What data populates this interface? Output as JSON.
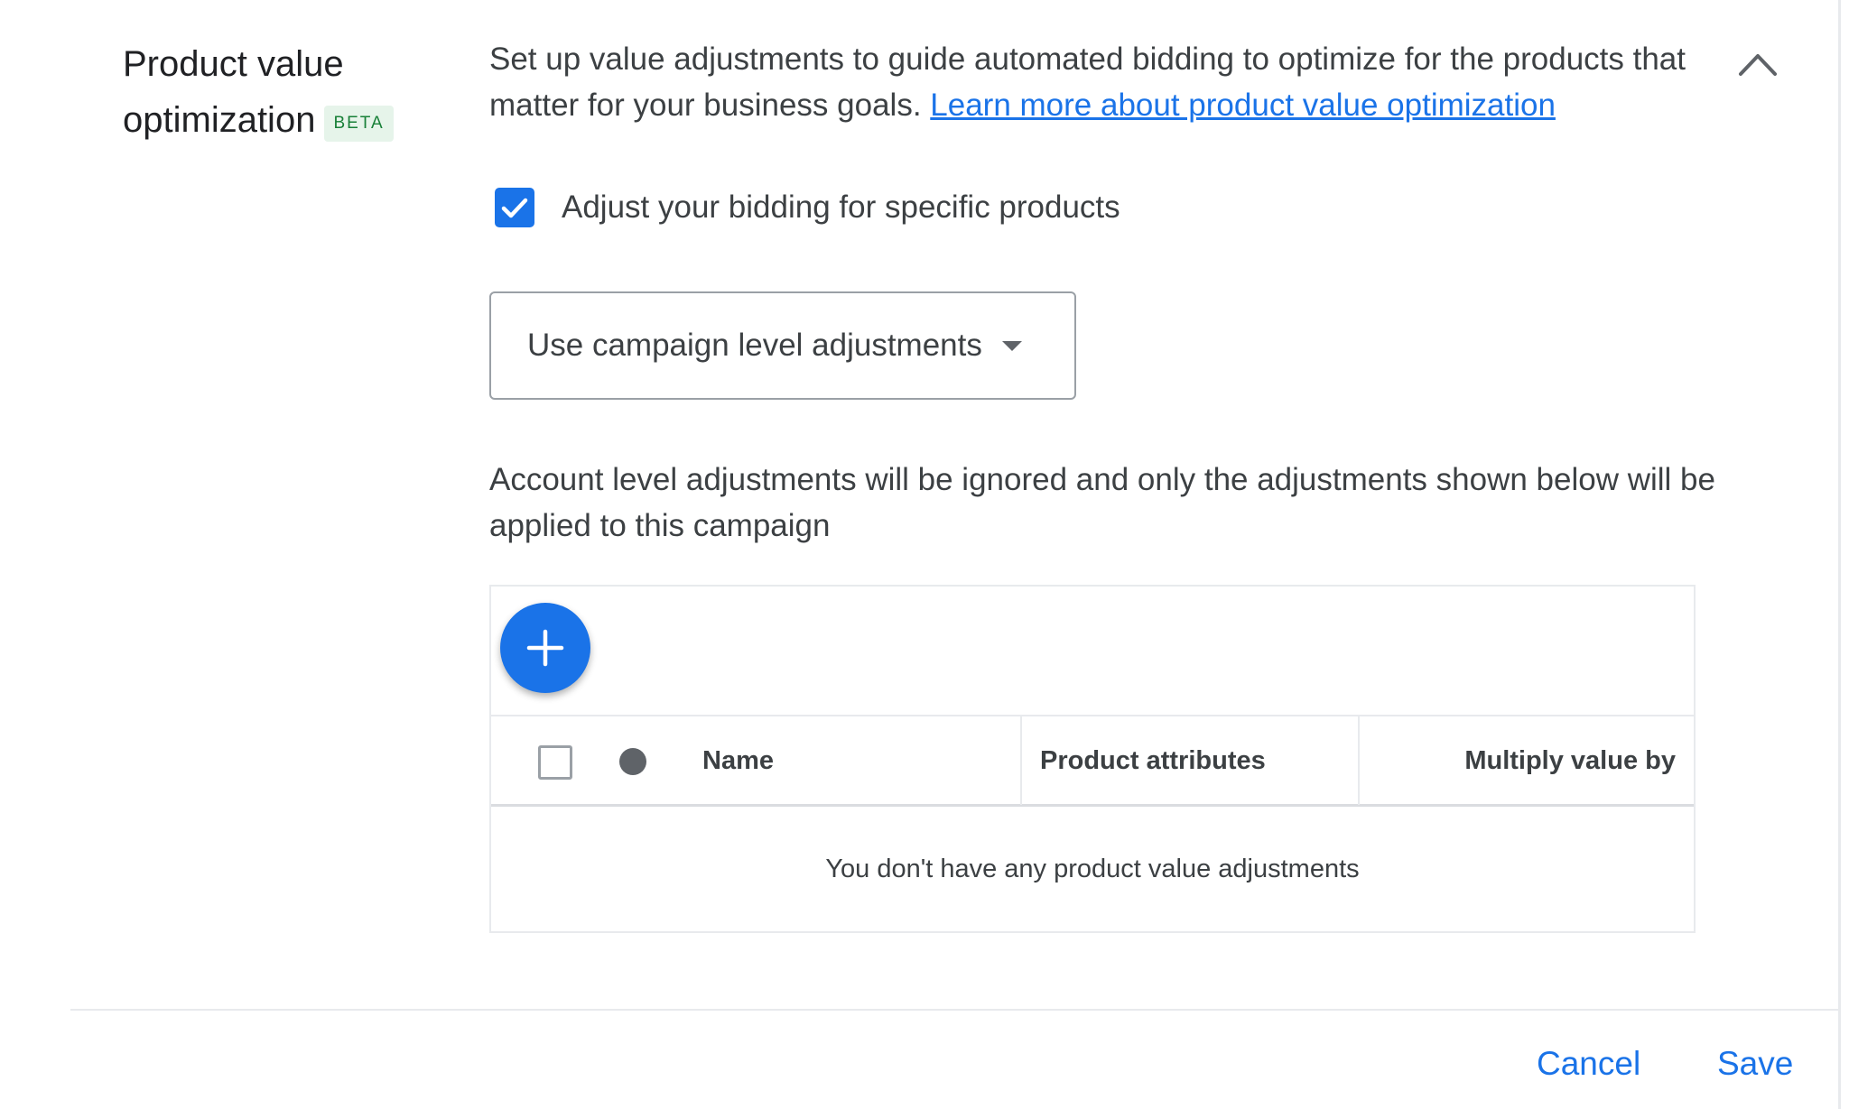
{
  "section": {
    "title": "Product value optimization",
    "badge": "BETA"
  },
  "description": {
    "text": "Set up value adjustments to guide automated bidding to optimize for the products that matter for your business goals. ",
    "link_label": "Learn more about product value optimization"
  },
  "collapse_icon": "chevron-up-icon",
  "checkbox": {
    "label": "Adjust your bidding for specific products",
    "checked": true
  },
  "dropdown": {
    "selected": "Use campaign level adjustments"
  },
  "info_text": "Account level adjustments will be ignored and only the adjustments shown below will be applied to this campaign",
  "table": {
    "add_icon": "plus-icon",
    "columns": [
      "Name",
      "Product attributes",
      "Multiply value by"
    ],
    "empty_message": "You don't have any product value adjustments"
  },
  "footer": {
    "cancel_label": "Cancel",
    "save_label": "Save"
  },
  "colors": {
    "accent": "#1a73e8",
    "badge_text": "#188038",
    "badge_bg": "#e6f4ea"
  }
}
